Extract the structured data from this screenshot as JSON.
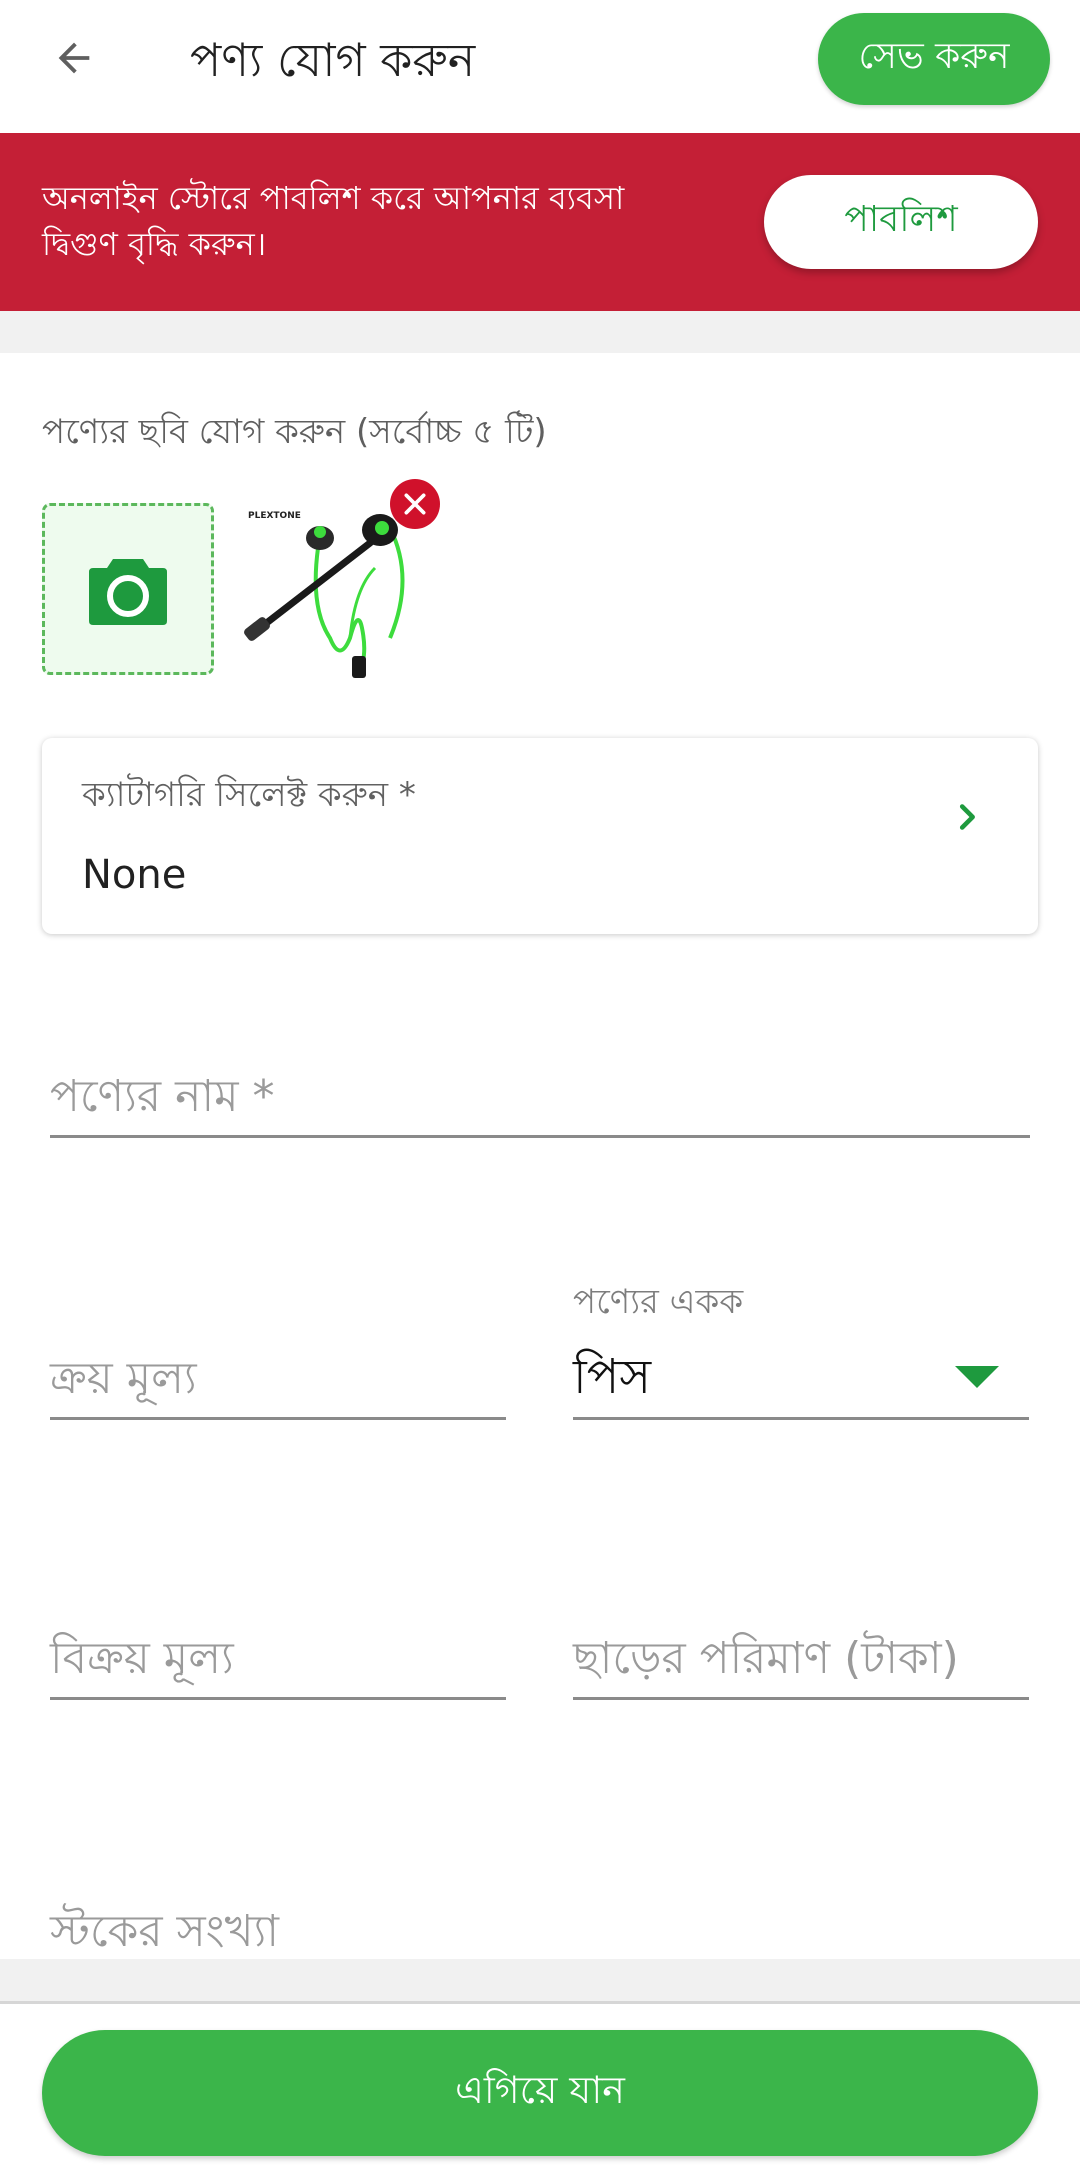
{
  "appbar": {
    "back_icon": "arrow-left-icon",
    "title": "পণ্য যোগ করুন",
    "save_label": "সেভ করুন"
  },
  "banner": {
    "text": "অনলাইন স্টোরে পাবলিশ করে আপনার ব্যবসা দ্বিগুণ বৃদ্ধি করুন।",
    "publish_label": "পাবলিশ",
    "background": "#c41f36"
  },
  "images": {
    "label": "পণ্যের ছবি যোগ করুন (সর্বোচ্চ ৫ টি)",
    "add_icon": "camera-icon",
    "remove_icon": "close-icon",
    "thumbnail_brand": "PLEXTONE"
  },
  "category": {
    "label": "ক্যাটাগরি  সিলেক্ট করুন *",
    "value": "None",
    "chevron_icon": "chevron-right-icon"
  },
  "form": {
    "name_placeholder": "পণ্যের নাম *",
    "buy_price_placeholder": "ক্রয় মূল্য",
    "unit_label": "পণ্যের একক",
    "unit_value": "পিস",
    "sell_price_placeholder": "বিক্রয় মূল্য",
    "discount_placeholder": "ছাড়ের পরিমাণ (টাকা)",
    "stock_placeholder": "স্টকের সংখ্যা"
  },
  "footer": {
    "next_label": "এগিয়ে যান"
  },
  "colors": {
    "primary_green": "#3bb54a",
    "accent_green": "#1e9a3e",
    "banner_red": "#c41f36",
    "remove_red": "#d0112b"
  }
}
